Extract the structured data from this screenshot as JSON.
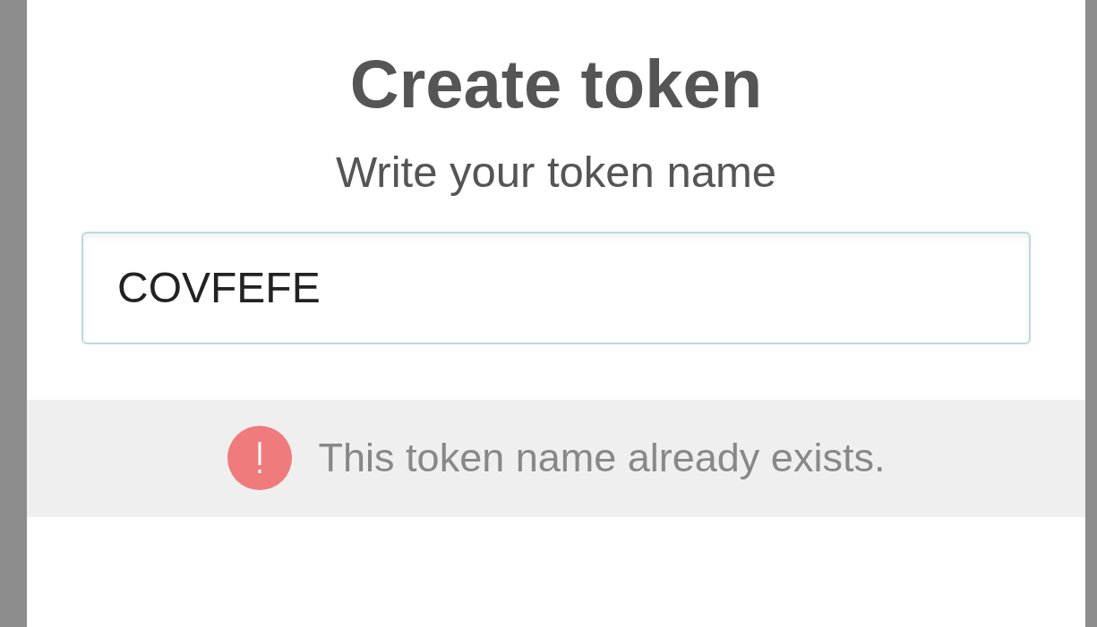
{
  "dialog": {
    "title": "Create token",
    "subtitle": "Write your token name",
    "token_field": {
      "value": "COVFEFE"
    },
    "error": {
      "message": "This token name already exists."
    }
  }
}
